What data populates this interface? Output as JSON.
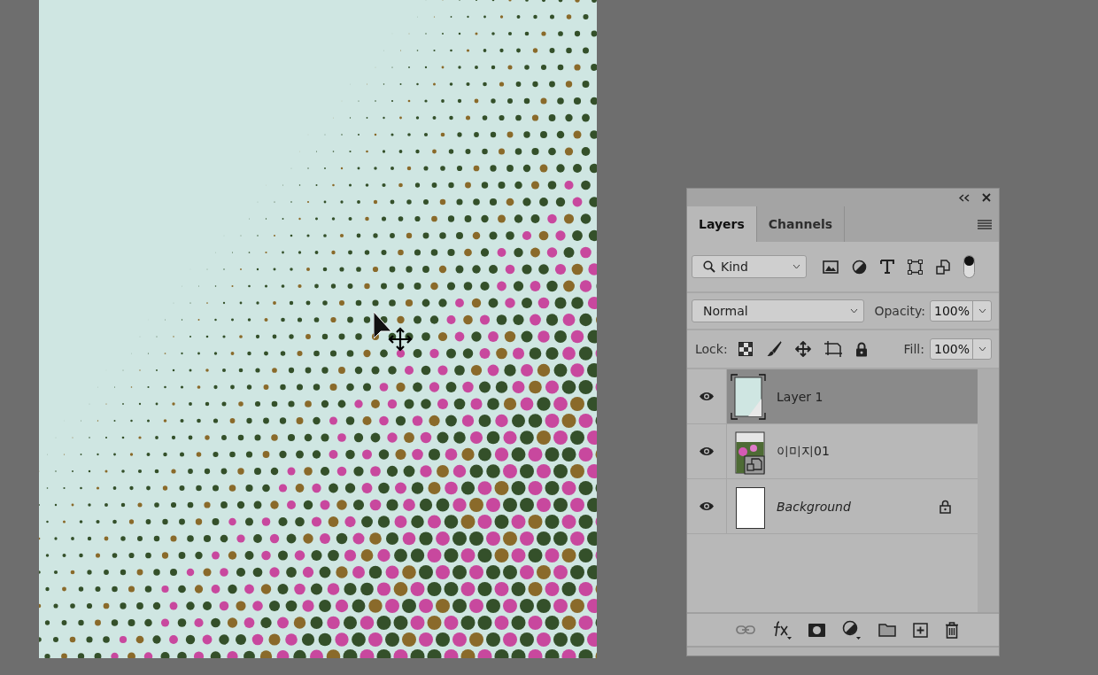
{
  "panel": {
    "tabs": [
      {
        "label": "Layers",
        "selected": true
      },
      {
        "label": "Channels",
        "selected": false
      }
    ],
    "filter": {
      "value": "Kind",
      "toggle_on": true
    },
    "blend_mode": "Normal",
    "opacity": {
      "label": "Opacity:",
      "value": "100%"
    },
    "lock_label": "Lock:",
    "fill": {
      "label": "Fill:",
      "value": "100%"
    },
    "layers": [
      {
        "name": "Layer 1",
        "kind": "pixel",
        "selected": true,
        "visible": true,
        "locked": false
      },
      {
        "name": "이미지01",
        "kind": "smart",
        "selected": false,
        "visible": true,
        "locked": false
      },
      {
        "name": "Background",
        "kind": "background",
        "selected": false,
        "visible": true,
        "locked": true
      }
    ]
  }
}
